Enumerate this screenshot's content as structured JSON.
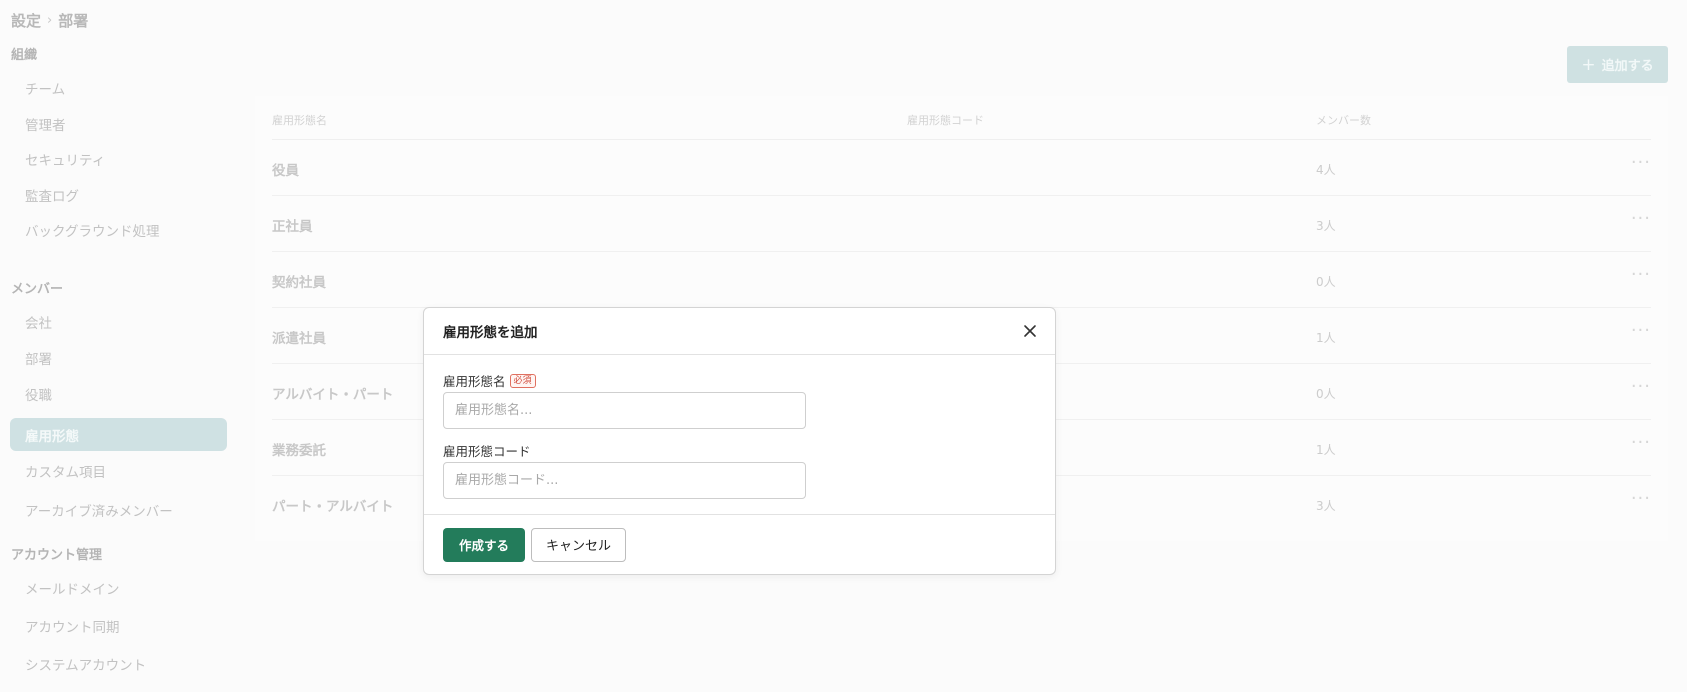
{
  "breadcrumb": {
    "root": "設定",
    "separator": "›",
    "current": "部署"
  },
  "sidebar": {
    "sections": [
      {
        "title": "組織",
        "items": [
          "チーム",
          "管理者",
          "セキュリティ",
          "監査ログ",
          "バックグラウンド処理"
        ]
      },
      {
        "title": "メンバー",
        "items": [
          "会社",
          "部署",
          "役職",
          "雇用形態",
          "カスタム項目",
          "アーカイブ済みメンバー"
        ]
      },
      {
        "title": "アカウント管理",
        "items": [
          "メールドメイン",
          "アカウント同期",
          "システムアカウント"
        ]
      }
    ],
    "active_item": "雇用形態"
  },
  "toolbar": {
    "add_label": "追加する"
  },
  "table": {
    "columns": [
      "雇用形態名",
      "雇用形態コード",
      "メンバー数"
    ],
    "rows": [
      {
        "name": "役員",
        "code": "",
        "count": "4人"
      },
      {
        "name": "正社員",
        "code": "",
        "count": "3人"
      },
      {
        "name": "契約社員",
        "code": "",
        "count": "0人"
      },
      {
        "name": "派遣社員",
        "code": "",
        "count": "1人"
      },
      {
        "name": "アルバイト・パート",
        "code": "",
        "count": "0人"
      },
      {
        "name": "業務委託",
        "code": "",
        "count": "1人"
      },
      {
        "name": "パート・アルバイト",
        "code": "",
        "count": "3人"
      }
    ],
    "row_menu": "···"
  },
  "modal": {
    "title": "雇用形態を追加",
    "fields": [
      {
        "label": "雇用形態名",
        "required_badge": "必須",
        "placeholder": "雇用形態名...",
        "value": ""
      },
      {
        "label": "雇用形態コード",
        "placeholder": "雇用形態コード...",
        "value": ""
      }
    ],
    "submit_label": "作成する",
    "cancel_label": "キャンセル"
  },
  "colors": {
    "accent": "#237c5b",
    "active_nav_bg": "#cfe1e3",
    "required": "#d04a3a"
  }
}
